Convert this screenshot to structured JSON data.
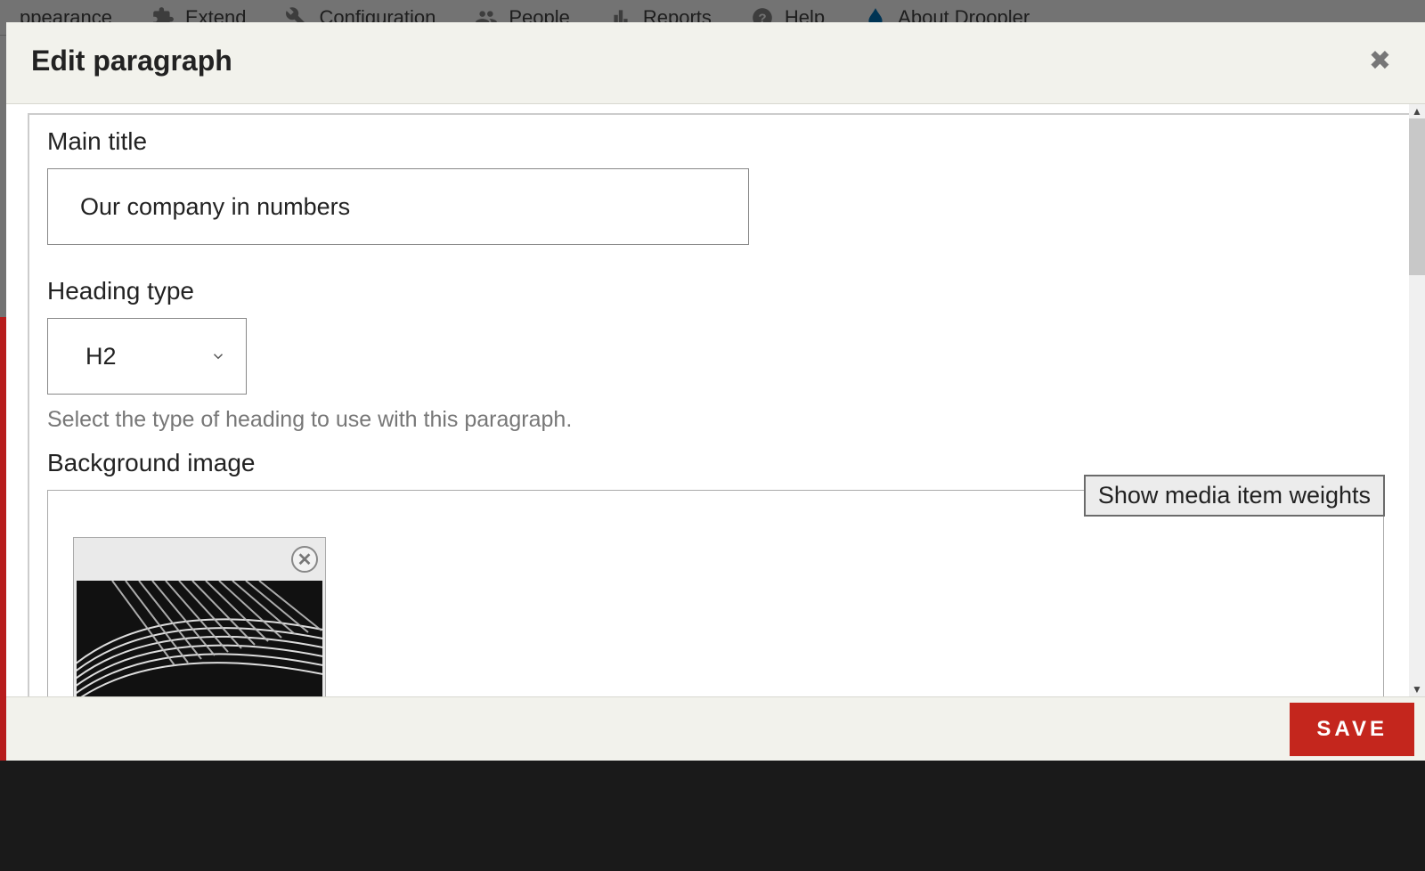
{
  "toolbar": {
    "appearance": "ppearance",
    "extend": "Extend",
    "configuration": "Configuration",
    "people": "People",
    "reports": "Reports",
    "help": "Help",
    "about": "About Droopler"
  },
  "modal": {
    "title": "Edit paragraph",
    "fields": {
      "main_title_label": "Main title",
      "main_title_value": "Our company in numbers",
      "heading_type_label": "Heading type",
      "heading_type_value": "H2",
      "heading_type_help": "Select the type of heading to use with this paragraph.",
      "bg_image_label": "Background image",
      "show_weights_label": "Show media item weights"
    },
    "save_label": "SAVE"
  }
}
